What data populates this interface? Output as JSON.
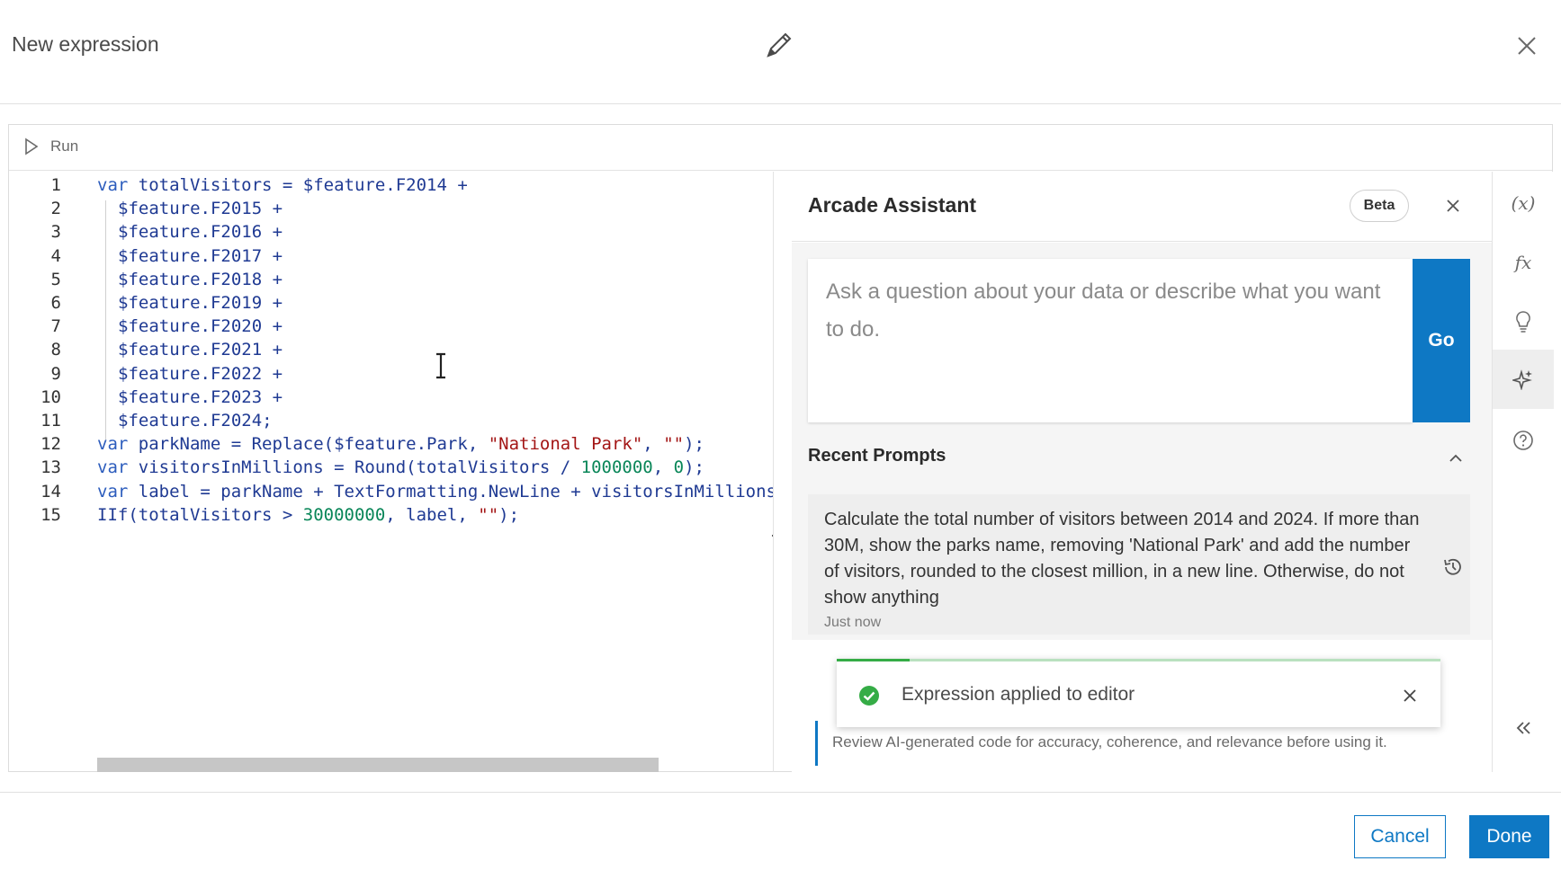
{
  "header": {
    "title": "New expression",
    "edit_icon": "pencil-icon",
    "close_icon": "close-icon"
  },
  "toolbar": {
    "run_label": "Run",
    "run_icon": "play-icon"
  },
  "code": {
    "line_numbers": [
      "1",
      "2",
      "3",
      "4",
      "5",
      "6",
      "7",
      "8",
      "9",
      "10",
      "11",
      "12",
      "13",
      "14",
      "15"
    ],
    "lines": [
      [
        {
          "t": "var ",
          "c": "kw"
        },
        {
          "t": "totalVisitors = $feature.F2014 +",
          "c": ""
        }
      ],
      [
        {
          "t": "$feature.F2015 +",
          "c": ""
        }
      ],
      [
        {
          "t": "$feature.F2016 +",
          "c": ""
        }
      ],
      [
        {
          "t": "$feature.F2017 +",
          "c": ""
        }
      ],
      [
        {
          "t": "$feature.F2018 +",
          "c": ""
        }
      ],
      [
        {
          "t": "$feature.F2019 +",
          "c": ""
        }
      ],
      [
        {
          "t": "$feature.F2020 +",
          "c": ""
        }
      ],
      [
        {
          "t": "$feature.F2021 +",
          "c": ""
        }
      ],
      [
        {
          "t": "$feature.F2022 +",
          "c": ""
        }
      ],
      [
        {
          "t": "$feature.F2023 +",
          "c": ""
        }
      ],
      [
        {
          "t": "$feature.F2024;",
          "c": ""
        }
      ],
      [
        {
          "t": "var ",
          "c": "kw"
        },
        {
          "t": "parkName = Replace($feature.Park, ",
          "c": ""
        },
        {
          "t": "\"National Park\"",
          "c": "str"
        },
        {
          "t": ", ",
          "c": ""
        },
        {
          "t": "\"\"",
          "c": "str"
        },
        {
          "t": ");",
          "c": ""
        }
      ],
      [
        {
          "t": "var ",
          "c": "kw"
        },
        {
          "t": "visitorsInMillions = Round(totalVisitors / ",
          "c": ""
        },
        {
          "t": "1000000",
          "c": "num"
        },
        {
          "t": ", ",
          "c": ""
        },
        {
          "t": "0",
          "c": "num"
        },
        {
          "t": ");",
          "c": ""
        }
      ],
      [
        {
          "t": "var ",
          "c": "kw"
        },
        {
          "t": "label = parkName + TextFormatting.NewLine + visitorsInMillions",
          "c": ""
        }
      ],
      [
        {
          "t": "IIf(totalVisitors > ",
          "c": ""
        },
        {
          "t": "30000000",
          "c": "num"
        },
        {
          "t": ", label, ",
          "c": ""
        },
        {
          "t": "\"\"",
          "c": "str"
        },
        {
          "t": ");",
          "c": ""
        }
      ]
    ]
  },
  "assistant": {
    "title": "Arcade Assistant",
    "badge": "Beta",
    "ask_placeholder": "Ask a question about your data or describe what you want to do.",
    "go_label": "Go",
    "recent_title": "Recent Prompts",
    "prompts": [
      {
        "text": "Calculate the total number of visitors between 2014 and 2024. If more than 30M, show the parks name, removing 'National Park' and add the number of visitors, rounded to the closest million, in a new line. Otherwise, do not show anything",
        "time": "Just now"
      }
    ],
    "disclaimer": "Review AI-generated code for accuracy, coherence, and relevance before using it."
  },
  "toast": {
    "message": "Expression applied to editor",
    "icon": "check-circle-icon",
    "progress_fraction": 0.12
  },
  "rail": {
    "items": [
      {
        "label": "(x)",
        "icon": "variables-icon"
      },
      {
        "label": "fx",
        "icon": "functions-icon"
      },
      {
        "label": "",
        "icon": "lightbulb-icon"
      },
      {
        "label": "",
        "icon": "sparkle-icon"
      },
      {
        "label": "",
        "icon": "help-icon"
      }
    ],
    "collapse_icon": "chevrons-left-icon"
  },
  "footer": {
    "cancel_label": "Cancel",
    "done_label": "Done"
  },
  "colors": {
    "accent": "#0e78c4",
    "success": "#35ac46"
  }
}
